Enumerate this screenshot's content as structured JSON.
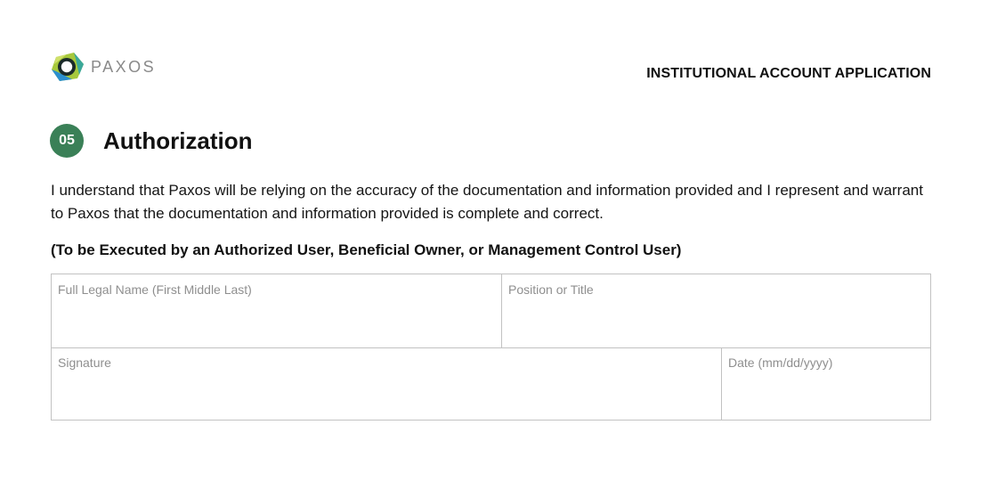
{
  "header": {
    "logo_text": "PAXOS",
    "document_title": "INSTITUTIONAL ACCOUNT APPLICATION"
  },
  "section": {
    "number": "05",
    "title": "Authorization",
    "paragraph": "I understand that Paxos will be relying on the accuracy of the documentation and information provided and I represent and warrant to Paxos that the documentation and information provided is complete and correct.",
    "instruction": "(To be Executed by an Authorized User, Beneficial Owner, or Management Control User)"
  },
  "form": {
    "full_name_label": "Full Legal Name (First Middle Last)",
    "full_name_value": "",
    "position_label": "Position or Title",
    "position_value": "",
    "signature_label": "Signature",
    "signature_value": "",
    "date_label": "Date (mm/dd/yyyy)",
    "date_value": ""
  },
  "colors": {
    "badge": "#3a8057",
    "logo_green": "#a6c83c",
    "logo_blue": "#2b8fcf",
    "logo_teal": "#3aa89a",
    "logo_ring": "#1a2a2a",
    "label_gray": "#8f8f8f",
    "border_gray": "#c2c2c2"
  }
}
